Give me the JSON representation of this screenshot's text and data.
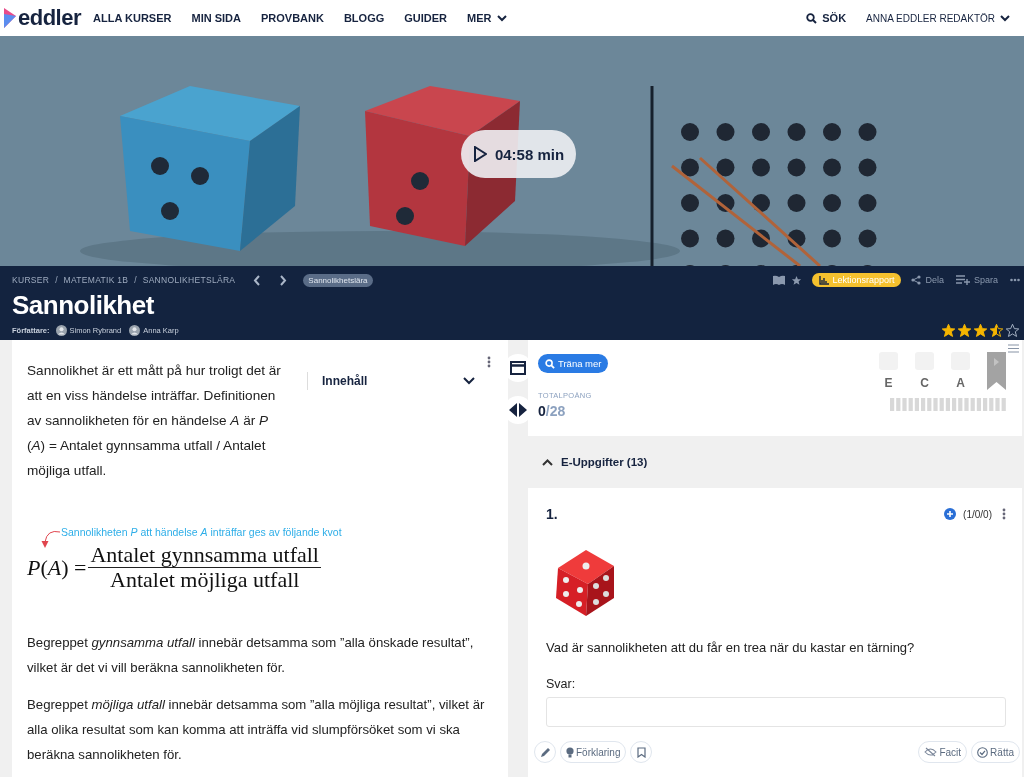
{
  "nav": {
    "logo": "eddler",
    "items": [
      {
        "label": "ALLA KURSER"
      },
      {
        "label": "MIN SIDA"
      },
      {
        "label": "PROVBANK"
      },
      {
        "label": "BLOGG"
      },
      {
        "label": "GUIDER"
      },
      {
        "label": "MER",
        "dropdown": true
      }
    ],
    "search": "SÖK",
    "user": "ANNA EDDLER REDAKTÖR"
  },
  "video": {
    "duration": "04:58 min"
  },
  "header": {
    "breadcrumb": [
      "KURSER",
      "MATEMATIK 1B",
      "SANNOLIKHETSLÄRA"
    ],
    "separator": "/",
    "tag": "Sannolikhetslära",
    "report": "Lektionsrapport",
    "share": "Dela",
    "save": "Spara",
    "title": "Sannolikhet",
    "authors_label": "Författare:",
    "authors": [
      "Simon Rybrand",
      "Anna Karp"
    ],
    "stars": 3.5
  },
  "article": {
    "intro": "Sannolikhet är ett mått på hur troligt det är att en viss händelse inträffar. Definitionen av sannolikheten för en händelse *A* är *P* (*A*) = Antalet gynnsamma utfall / Antalet möjliga utfall.",
    "toc": "Innehåll",
    "formula": {
      "note": "Sannolikheten *P* att händelse *A* inträffar ges av följande kvot",
      "lhs": "*P*(*A*) =",
      "numerator": "Antalet gynnsamma utfall",
      "denominator": "Antalet möjliga utfall"
    },
    "paragraphs": [
      "Begreppet *gynnsamma utfall* innebär detsamma som ”alla önskade resultat”, vilket är det vi vill beräkna sannolikheten för.",
      "Begreppet *möjliga utfall* innebär detsamma som ”alla möjliga resultat”, vilket är alla olika resultat som kan komma att inträffa vid slumpförsöket som vi ska beräkna sannolikheten för."
    ]
  },
  "score": {
    "train": "Träna mer",
    "grades": [
      "E",
      "C",
      "A"
    ],
    "total_label": "TOTALPOÄNG",
    "points": "0",
    "max": "/28"
  },
  "section": {
    "title": "E-Uppgifter (13)",
    "expanded": true
  },
  "question": {
    "number": "1.",
    "points": "(1/0/0)",
    "text": "Vad är sannolikheten att du får en trea när du kastar en tärning?",
    "answer_label": "Svar:",
    "actions": {
      "explain": "Förklaring",
      "key": "Facit",
      "check": "Rätta"
    }
  }
}
